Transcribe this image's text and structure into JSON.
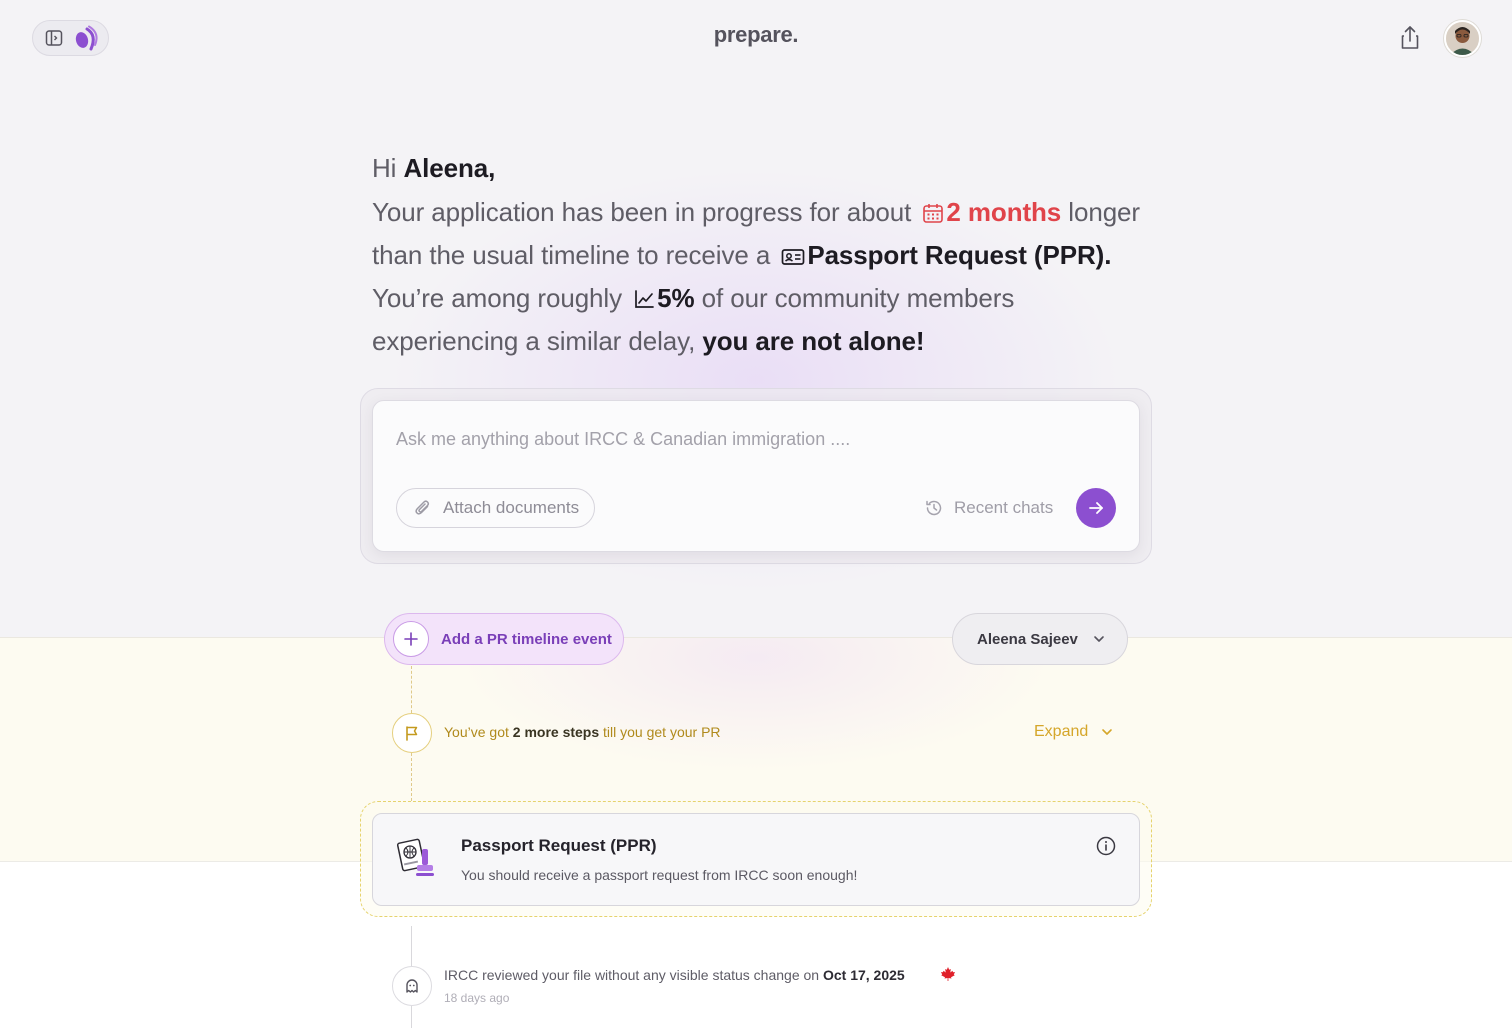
{
  "header": {
    "brand": "prepare.",
    "icons": {
      "sidebar_toggle": "sidebar-toggle-icon",
      "logo": "app-logo-icon",
      "share": "share-icon"
    },
    "avatar": "user-avatar"
  },
  "greeting": {
    "hi": "Hi",
    "name": "Aleena,",
    "line1_pre": "Your application has been in progress for about",
    "duration": "2 months",
    "line2_pre": "longer than the usual timeline to receive a",
    "doc_name": "Passport Request (PPR).",
    "line3_pre": "You’re among roughly",
    "percent": "5%",
    "line3_post": "of our community members experiencing a similar delay,",
    "closing": "you are not alone!",
    "colors": {
      "highlight": "#e0444a"
    }
  },
  "ask": {
    "placeholder": "Ask me anything about IRCC & Canadian immigration ....",
    "attach_label": "Attach documents",
    "recent_label": "Recent chats",
    "send_color": "#8c4fd0"
  },
  "timeline": {
    "add_event_label": "Add a PR timeline event",
    "user_select": "Aleena Sajeev",
    "steps": {
      "pre": "You’ve got",
      "count": "2 more steps",
      "post": "till you get your PR",
      "expand_label": "Expand"
    },
    "next_step": {
      "title": "Passport Request (PPR)",
      "description": "You should receive a passport request from IRCC soon enough!"
    },
    "history": [
      {
        "text": "IRCC reviewed your file without any visible status change on",
        "date": "Oct 17, 2025",
        "time_ago": "18 days ago",
        "icon": "ghost-icon"
      }
    ]
  }
}
